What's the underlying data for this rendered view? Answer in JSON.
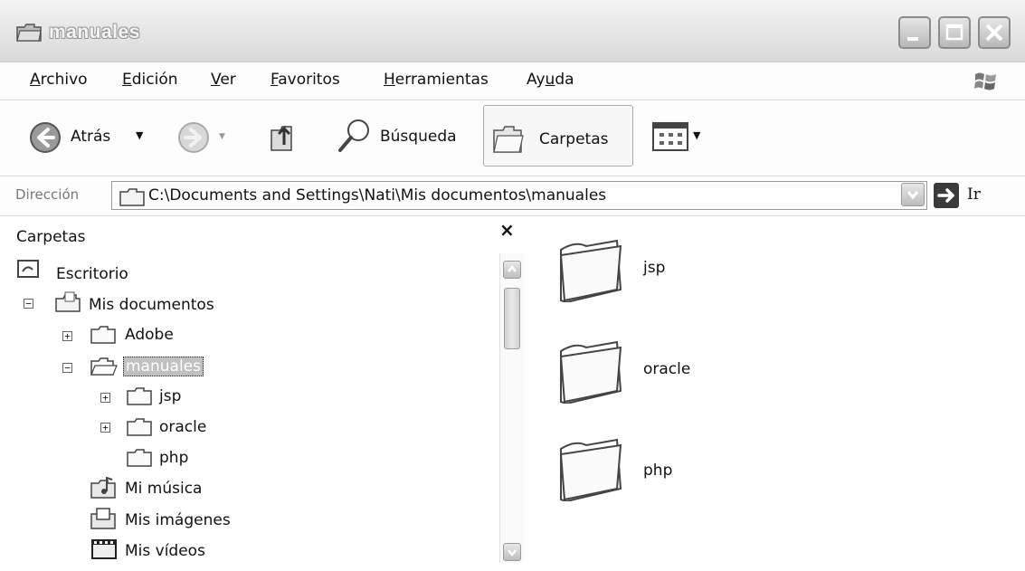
{
  "window": {
    "title": "manuales"
  },
  "menu": [
    "Archivo",
    "Edición",
    "Ver",
    "Favoritos",
    "Herramientas",
    "Ayuda"
  ],
  "menu_underline": [
    "A",
    "E",
    "V",
    "F",
    "H",
    "u"
  ],
  "toolbar": {
    "back_label": "Atrás",
    "search_label": "Búsqueda",
    "folders_label": "Carpetas"
  },
  "address": {
    "label": "Dirección",
    "value": "C:\\Documents and Settings\\Nati\\Mis documentos\\manuales",
    "go_label": "Ir"
  },
  "folders_pane": {
    "title": "Carpetas",
    "close": "×",
    "tree": [
      {
        "label": "Escritorio"
      },
      {
        "label": "Mis documentos"
      },
      {
        "label": "Adobe"
      },
      {
        "label": "manuales"
      },
      {
        "label": "jsp"
      },
      {
        "label": "oracle"
      },
      {
        "label": "php"
      },
      {
        "label": "Mi música"
      },
      {
        "label": "Mis imágenes"
      },
      {
        "label": "Mis vídeos"
      }
    ]
  },
  "content": {
    "items": [
      {
        "label": "jsp"
      },
      {
        "label": "oracle"
      },
      {
        "label": "php"
      }
    ]
  }
}
